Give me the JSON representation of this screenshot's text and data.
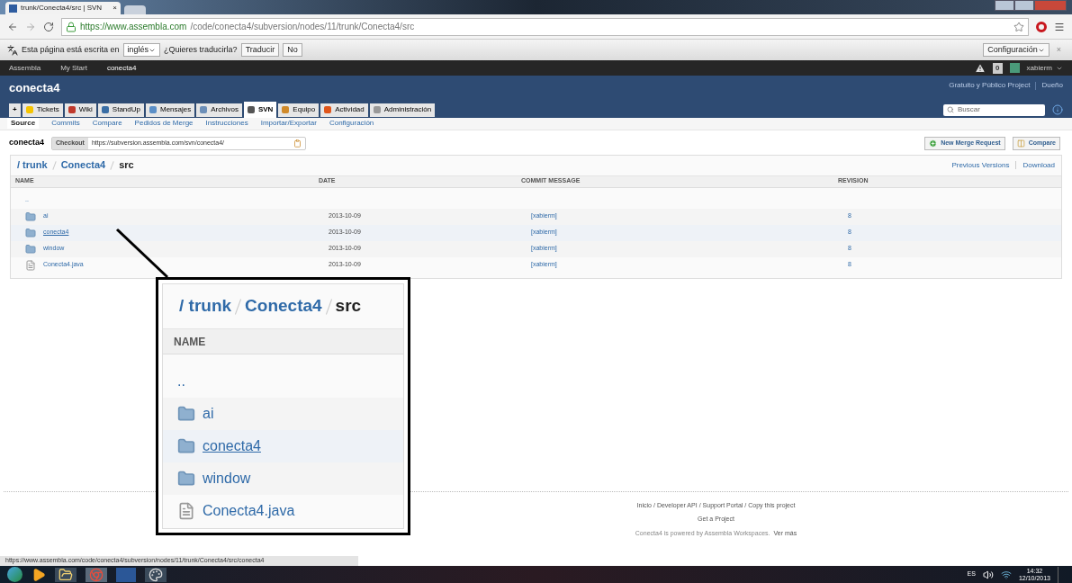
{
  "browser": {
    "tab_title": "trunk/Conecta4/src | SVN",
    "tab_close": "×",
    "url_host": "https://www.assembla.com",
    "url_path": "/code/conecta4/subversion/nodes/11/trunk/Conecta4/src"
  },
  "translate_bar": {
    "text": "Esta página está escrita en",
    "language": "inglés",
    "question": "¿Quieres traducirla?",
    "translate": "Traducir",
    "no": "No",
    "settings": "Configuración",
    "close": "×"
  },
  "top_nav": {
    "crumbs": [
      "Assembla",
      "My Start",
      "conecta4"
    ],
    "alerts": "0",
    "user": "xabierm"
  },
  "project": {
    "name": "conecta4",
    "plan": "Gratuito y Público Project",
    "role": "Dueño",
    "search_placeholder": "Buscar"
  },
  "tabs": [
    {
      "label": "+",
      "kind": "plus",
      "selected": false
    },
    {
      "label": "Tickets",
      "kind": "tickets",
      "selected": false
    },
    {
      "label": "Wiki",
      "kind": "wiki",
      "selected": false
    },
    {
      "label": "StandUp",
      "kind": "standup",
      "selected": false
    },
    {
      "label": "Mensajes",
      "kind": "messages",
      "selected": false
    },
    {
      "label": "Archivos",
      "kind": "files",
      "selected": false
    },
    {
      "label": "SVN",
      "kind": "svn",
      "selected": true
    },
    {
      "label": "Equipo",
      "kind": "team",
      "selected": false
    },
    {
      "label": "Actividad",
      "kind": "activity",
      "selected": false
    },
    {
      "label": "Administración",
      "kind": "admin",
      "selected": false
    }
  ],
  "subnav": [
    {
      "label": "Source",
      "selected": true
    },
    {
      "label": "Commits",
      "selected": false
    },
    {
      "label": "Compare",
      "selected": false
    },
    {
      "label": "Pedidos de Merge",
      "selected": false
    },
    {
      "label": "Instrucciones",
      "selected": false
    },
    {
      "label": "Importar/Exportar",
      "selected": false
    },
    {
      "label": "Configuración",
      "selected": false
    }
  ],
  "checkout": {
    "repo": "conecta4",
    "label": "Checkout",
    "url": "https://subversion.assembla.com/svn/conecta4/",
    "new_merge": "New Merge Request",
    "compare": "Compare"
  },
  "browser_panel": {
    "path": [
      "/ trunk",
      "Conecta4",
      "src"
    ],
    "links": [
      "Previous Versions",
      "Download"
    ],
    "columns": [
      "NAME",
      "DATE",
      "COMMIT MESSAGE",
      "REVISION"
    ],
    "rows": [
      {
        "kind": "parent",
        "name": "..",
        "hovered": false
      },
      {
        "kind": "folder",
        "name": "ai",
        "date": "2013-10-09",
        "message": "[xabierm]",
        "revision": "8",
        "hovered": false
      },
      {
        "kind": "folder",
        "name": "conecta4",
        "date": "2013-10-09",
        "message": "[xabierm]",
        "revision": "8",
        "hovered": true
      },
      {
        "kind": "folder",
        "name": "window",
        "date": "2013-10-09",
        "message": "[xabierm]",
        "revision": "8",
        "hovered": false
      },
      {
        "kind": "file",
        "name": "Conecta4.java",
        "date": "2013-10-09",
        "message": "[xabierm]",
        "revision": "8",
        "hovered": false
      }
    ]
  },
  "callout": {
    "path": [
      "/ trunk",
      "Conecta4",
      "src"
    ],
    "column": "NAME",
    "rows": [
      {
        "kind": "parent",
        "name": "..",
        "hovered": false
      },
      {
        "kind": "folder",
        "name": "ai",
        "hovered": false
      },
      {
        "kind": "folder",
        "name": "conecta4",
        "hovered": true
      },
      {
        "kind": "folder",
        "name": "window",
        "hovered": false
      },
      {
        "kind": "file",
        "name": "Conecta4.java",
        "hovered": false
      }
    ]
  },
  "footer": {
    "links": [
      "Inicio",
      "Developer API",
      "Support Portal",
      "Copy this project"
    ],
    "separator": "/",
    "get_project": "Get a Project",
    "powered": "Conecta4 is powered by Assembla Workspaces.",
    "more": "Ver más"
  },
  "status_url": "https://www.assembla.com/code/conecta4/subversion/nodes/11/trunk/Conecta4/src/conecta4",
  "taskbar": {
    "language": "ES",
    "time": "14:32",
    "date": "12/10/2013"
  }
}
